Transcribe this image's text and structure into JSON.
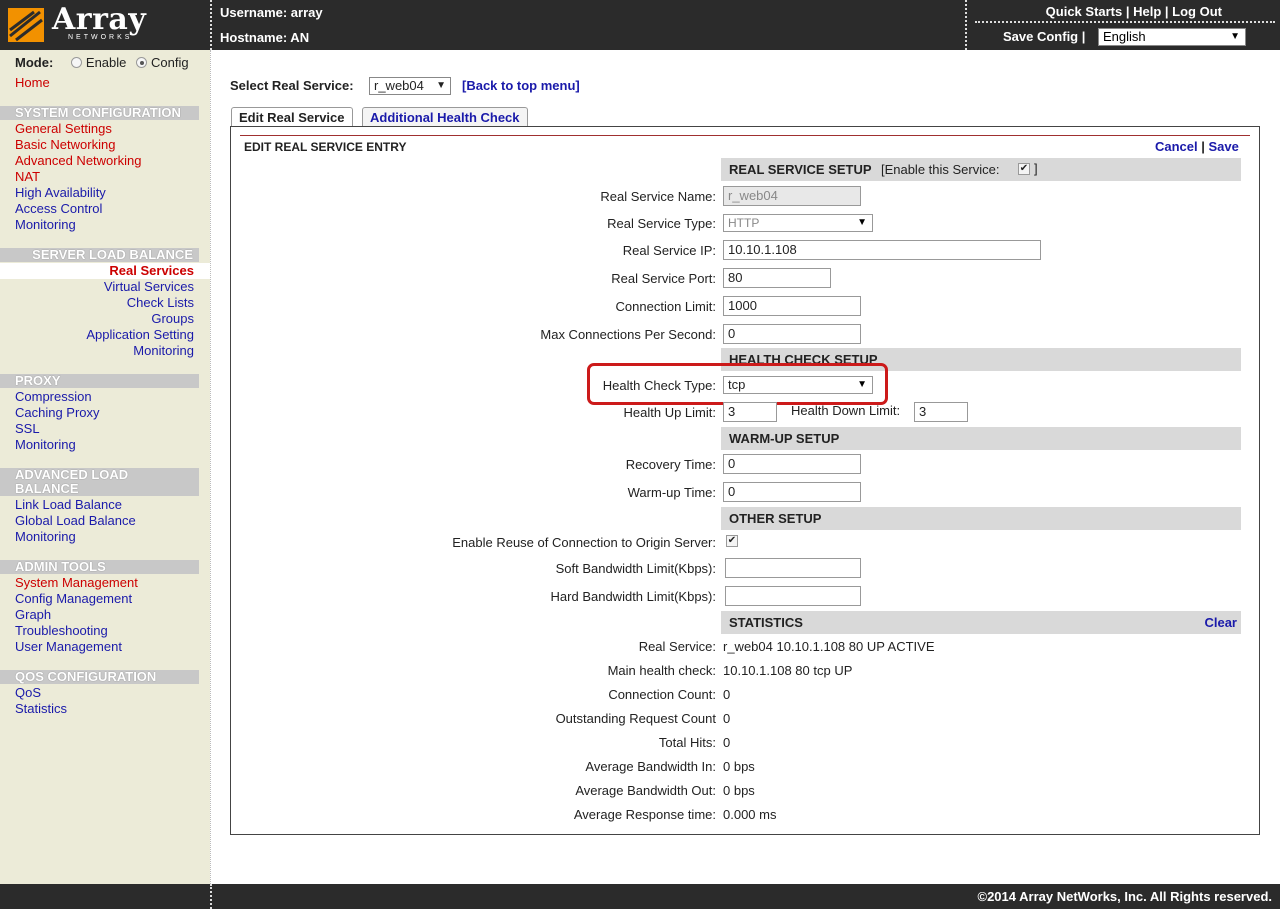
{
  "header": {
    "logo_text": "Array",
    "logo_sub": "NETWORKS",
    "username": "Username: array",
    "hostname": "Hostname: AN",
    "quick_starts": "Quick Starts",
    "help": "Help",
    "logout": "Log Out",
    "save_config": "Save Config",
    "language": "English"
  },
  "sidebar": {
    "mode_label": "Mode:",
    "mode_enable": "Enable",
    "mode_config": "Config",
    "home": "Home",
    "system_config": {
      "title": "SYSTEM CONFIGURATION",
      "items": [
        "General Settings",
        "Basic Networking",
        "Advanced Networking",
        "NAT",
        "High Availability",
        "Access Control",
        "Monitoring"
      ]
    },
    "slb": {
      "title": "SERVER LOAD BALANCE",
      "items": [
        "Real Services",
        "Virtual Services",
        "Check Lists",
        "Groups",
        "Application Setting",
        "Monitoring"
      ]
    },
    "proxy": {
      "title": "PROXY",
      "items": [
        "Compression",
        "Caching Proxy",
        "SSL",
        "Monitoring"
      ]
    },
    "alb": {
      "title_line1": "ADVANCED LOAD",
      "title_line2": "BALANCE",
      "items": [
        "Link Load Balance",
        "Global Load Balance",
        "Monitoring"
      ]
    },
    "admin": {
      "title": "ADMIN TOOLS",
      "items": [
        "System Management",
        "Config Management",
        "Graph",
        "Troubleshooting",
        "User Management"
      ]
    },
    "qos": {
      "title": "QOS CONFIGURATION",
      "items": [
        "QoS",
        "Statistics"
      ]
    }
  },
  "main": {
    "select_label": "Select Real Service:",
    "select_value": "r_web04",
    "back_link": "[Back to top menu]",
    "tabs": [
      "Edit Real Service",
      "Additional Health Check"
    ],
    "panel_title": "EDIT REAL SERVICE ENTRY",
    "cancel": "Cancel",
    "save": "Save",
    "real_service_setup": {
      "title": "REAL SERVICE SETUP",
      "enable_label_pre": "[Enable this Service:",
      "enable_label_post": "]",
      "name_label": "Real Service Name:",
      "name_value": "r_web04",
      "type_label": "Real Service Type:",
      "type_value": "HTTP",
      "ip_label": "Real Service IP:",
      "ip_value": "10.10.1.108",
      "port_label": "Real Service Port:",
      "port_value": "80",
      "conn_limit_label": "Connection Limit:",
      "conn_limit_value": "1000",
      "max_cps_label": "Max Connections Per Second:",
      "max_cps_value": "0"
    },
    "health_check_setup": {
      "title": "HEALTH CHECK SETUP",
      "type_label": "Health Check Type:",
      "type_value": "tcp",
      "up_label": "Health Up Limit:",
      "up_value": "3",
      "down_label": "Health Down Limit:",
      "down_value": "3"
    },
    "warmup_setup": {
      "title": "WARM-UP SETUP",
      "recovery_label": "Recovery Time:",
      "recovery_value": "0",
      "warmup_label": "Warm-up Time:",
      "warmup_value": "0"
    },
    "other_setup": {
      "title": "OTHER SETUP",
      "reuse_label": "Enable Reuse of Connection to Origin Server:",
      "soft_bw_label": "Soft Bandwidth Limit(Kbps):",
      "hard_bw_label": "Hard Bandwidth Limit(Kbps):"
    },
    "statistics": {
      "title": "STATISTICS",
      "clear": "Clear",
      "rows": [
        {
          "label": "Real Service:",
          "value": "r_web04 10.10.1.108 80 UP ACTIVE"
        },
        {
          "label": "Main health check:",
          "value": "10.10.1.108 80 tcp UP"
        },
        {
          "label": "Connection Count:",
          "value": "0"
        },
        {
          "label": "Outstanding Request Count",
          "value": "0"
        },
        {
          "label": "Total Hits:",
          "value": "0"
        },
        {
          "label": "Average Bandwidth In:",
          "value": "0 bps"
        },
        {
          "label": "Average Bandwidth Out:",
          "value": "0 bps"
        },
        {
          "label": "Average Response time:",
          "value": "0.000 ms"
        }
      ]
    }
  },
  "footer": {
    "copyright": "©2014 Array NetWorks, Inc. All Rights reserved."
  }
}
